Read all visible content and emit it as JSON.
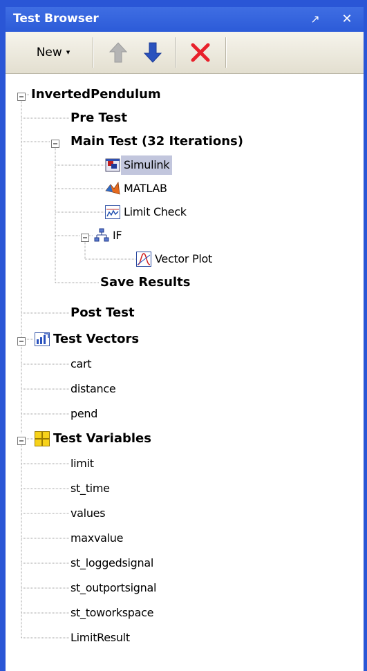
{
  "panel": {
    "title": "Test Browser",
    "controls": {
      "undock": "↗",
      "close": "✕"
    }
  },
  "toolbar": {
    "new_label": "New",
    "new_dropdown": "▾",
    "buttons": [
      {
        "name": "move-up",
        "icon": "up-arrow-icon",
        "enabled": false
      },
      {
        "name": "move-down",
        "icon": "down-arrow-icon",
        "enabled": true
      },
      {
        "name": "delete",
        "icon": "delete-x-icon",
        "enabled": true
      }
    ]
  },
  "tree": [
    {
      "label": "InvertedPendulum",
      "bold": true,
      "level": 0,
      "expander": "minus",
      "icon": ""
    },
    {
      "label": "Pre Test",
      "bold": true,
      "level": 1,
      "icon": ""
    },
    {
      "label": "Main Test (32 Iterations)",
      "bold": true,
      "level": 1,
      "expander": "minus",
      "icon": ""
    },
    {
      "label": "Simulink",
      "bold": false,
      "level": 2,
      "icon": "simulink-icon",
      "selected": true
    },
    {
      "label": "MATLAB",
      "bold": false,
      "level": 2,
      "icon": "matlab-icon"
    },
    {
      "label": "Limit Check",
      "bold": false,
      "level": 2,
      "icon": "limit-check-icon"
    },
    {
      "label": "IF",
      "bold": false,
      "level": 2,
      "expander": "minus",
      "icon": "if-icon"
    },
    {
      "label": "Vector Plot",
      "bold": false,
      "level": 3,
      "icon": "vector-plot-icon"
    },
    {
      "label": "Save Results",
      "bold": true,
      "level": 2,
      "icon": ""
    },
    {
      "label": "Post Test",
      "bold": true,
      "level": 1,
      "icon": ""
    },
    {
      "label": "Test Vectors",
      "bold": true,
      "level": 0,
      "expander": "minus",
      "icon": "test-vectors-icon"
    },
    {
      "label": "cart",
      "bold": false,
      "level": 1,
      "icon": ""
    },
    {
      "label": "distance",
      "bold": false,
      "level": 1,
      "icon": ""
    },
    {
      "label": "pend",
      "bold": false,
      "level": 1,
      "icon": ""
    },
    {
      "label": "Test Variables",
      "bold": true,
      "level": 0,
      "expander": "minus",
      "icon": "test-variables-icon"
    },
    {
      "label": "limit",
      "bold": false,
      "level": 1,
      "icon": ""
    },
    {
      "label": "st_time",
      "bold": false,
      "level": 1,
      "icon": ""
    },
    {
      "label": "values",
      "bold": false,
      "level": 1,
      "icon": ""
    },
    {
      "label": "maxvalue",
      "bold": false,
      "level": 1,
      "icon": ""
    },
    {
      "label": "st_loggedsignal",
      "bold": false,
      "level": 1,
      "icon": ""
    },
    {
      "label": "st_outportsignal",
      "bold": false,
      "level": 1,
      "icon": ""
    },
    {
      "label": "st_toworkspace",
      "bold": false,
      "level": 1,
      "icon": ""
    },
    {
      "label": "LimitResult",
      "bold": false,
      "level": 1,
      "icon": ""
    }
  ],
  "colors": {
    "titlebar": "#2c5bd8",
    "selection": "#c2c6dd",
    "tree_line": "#a0a0a0",
    "delete": "#e8202a",
    "down_arrow": "#2a52be",
    "up_arrow_disabled": "#b4b4b4"
  }
}
